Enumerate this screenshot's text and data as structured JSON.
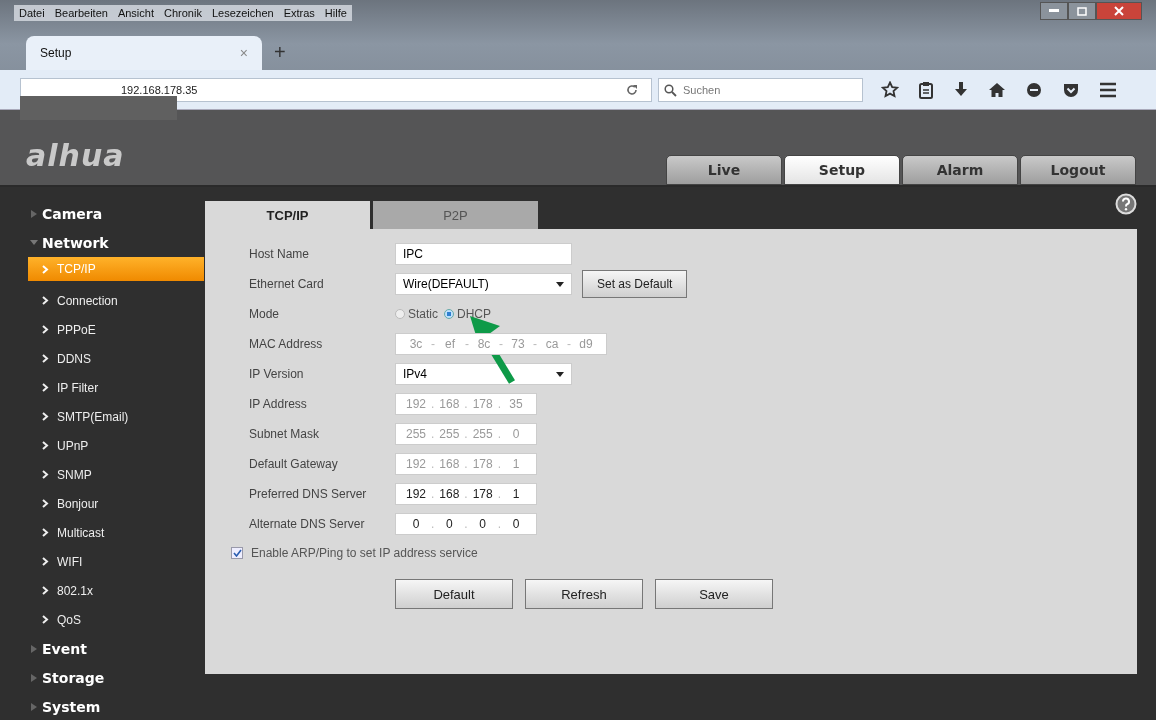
{
  "browser": {
    "menu": [
      "Datei",
      "Bearbeiten",
      "Ansicht",
      "Chronik",
      "Lesezeichen",
      "Extras",
      "Hilfe"
    ],
    "tab": {
      "title": "Setup",
      "close": "×",
      "new": "+"
    },
    "url": "192.168.178.35",
    "search": {
      "placeholder": "Suchen"
    }
  },
  "header": {
    "logo": "alhua",
    "nav": [
      {
        "label": "Live",
        "selected": false
      },
      {
        "label": "Setup",
        "selected": true
      },
      {
        "label": "Alarm",
        "selected": false
      },
      {
        "label": "Logout",
        "selected": false
      }
    ]
  },
  "sidebar": {
    "items": [
      {
        "label": "Camera",
        "expanded": false
      },
      {
        "label": "Network",
        "expanded": true,
        "children": [
          {
            "label": "TCP/IP",
            "selected": true
          },
          {
            "label": "Connection",
            "selected": false
          },
          {
            "label": "PPPoE",
            "selected": false
          },
          {
            "label": "DDNS",
            "selected": false
          },
          {
            "label": "IP Filter",
            "selected": false
          },
          {
            "label": "SMTP(Email)",
            "selected": false
          },
          {
            "label": "UPnP",
            "selected": false
          },
          {
            "label": "SNMP",
            "selected": false
          },
          {
            "label": "Bonjour",
            "selected": false
          },
          {
            "label": "Multicast",
            "selected": false
          },
          {
            "label": "WIFI",
            "selected": false
          },
          {
            "label": "802.1x",
            "selected": false
          },
          {
            "label": "QoS",
            "selected": false
          }
        ]
      },
      {
        "label": "Event",
        "expanded": false
      },
      {
        "label": "Storage",
        "expanded": false
      },
      {
        "label": "System",
        "expanded": false
      }
    ]
  },
  "content": {
    "tabs": [
      {
        "label": "TCP/IP",
        "selected": true
      },
      {
        "label": "P2P",
        "selected": false
      }
    ],
    "form": [
      {
        "kind": "text",
        "label": "Host Name",
        "value": "IPC"
      },
      {
        "kind": "select",
        "label": "Ethernet Card",
        "value": "Wire(DEFAULT)",
        "button": "Set as Default"
      },
      {
        "kind": "radio",
        "label": "Mode",
        "options": [
          {
            "label": "Static",
            "selected": false
          },
          {
            "label": "DHCP",
            "selected": true
          }
        ]
      },
      {
        "kind": "octets",
        "label": "MAC Address",
        "disabled": true,
        "separator": "-",
        "octets": [
          "3c",
          "ef",
          "8c",
          "73",
          "ca",
          "d9"
        ]
      },
      {
        "kind": "select",
        "label": "IP Version",
        "value": "IPv4"
      },
      {
        "kind": "octets",
        "label": "IP Address",
        "disabled": true,
        "separator": ".",
        "octets": [
          "192",
          "168",
          "178",
          "35"
        ]
      },
      {
        "kind": "octets",
        "label": "Subnet Mask",
        "disabled": true,
        "separator": ".",
        "octets": [
          "255",
          "255",
          "255",
          "0"
        ]
      },
      {
        "kind": "octets",
        "label": "Default Gateway",
        "disabled": true,
        "separator": ".",
        "octets": [
          "192",
          "168",
          "178",
          "1"
        ]
      },
      {
        "kind": "octets",
        "label": "Preferred DNS Server",
        "disabled": false,
        "separator": ".",
        "octets": [
          "192",
          "168",
          "178",
          "1"
        ]
      },
      {
        "kind": "octets",
        "label": "Alternate DNS Server",
        "disabled": false,
        "separator": ".",
        "octets": [
          "0",
          "0",
          "0",
          "0"
        ]
      }
    ],
    "arp": {
      "label": "Enable ARP/Ping to set IP address service",
      "checked": true
    },
    "buttons": [
      "Default",
      "Refresh",
      "Save"
    ]
  }
}
